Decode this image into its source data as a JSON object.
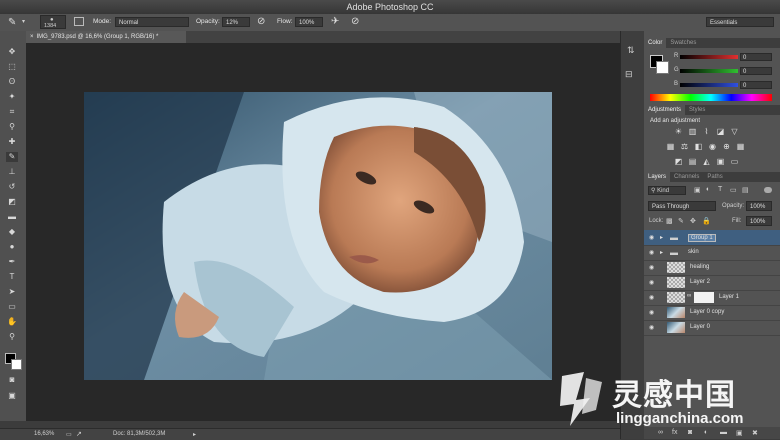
{
  "window": {
    "title": "Adobe Photoshop CC"
  },
  "options_bar": {
    "brush_size": "1384",
    "mode_label": "Mode:",
    "mode_value": "Normal",
    "opacity_label": "Opacity:",
    "opacity_value": "12%",
    "flow_label": "Flow:",
    "flow_value": "100%",
    "workspace": "Essentials"
  },
  "document_tab": {
    "label": "IMG_9783.psd @ 16,6% (Group 1, RGB/16) *"
  },
  "status_bar": {
    "zoom": "16,63%",
    "doc_info": "Doc: 81,3M/502,3M"
  },
  "color_panel": {
    "tabs": [
      "Color",
      "Swatches"
    ],
    "channels": [
      {
        "label": "R",
        "value": "0",
        "color": "#e03030"
      },
      {
        "label": "G",
        "value": "0",
        "color": "#30c030"
      },
      {
        "label": "B",
        "value": "0",
        "color": "#3050e0"
      }
    ]
  },
  "adjustments_panel": {
    "tabs": [
      "Adjustments",
      "Styles"
    ],
    "heading": "Add an adjustment"
  },
  "layers_panel": {
    "tabs": [
      "Layers",
      "Channels",
      "Paths"
    ],
    "kind_label": "Kind",
    "blend_mode": "Pass Through",
    "opacity_label": "Opacity:",
    "opacity_value": "100%",
    "lock_label": "Lock:",
    "fill_label": "Fill:",
    "fill_value": "100%",
    "layers": [
      {
        "name": "Group 1",
        "type": "group",
        "selected": true
      },
      {
        "name": "skin",
        "type": "group",
        "selected": false
      },
      {
        "name": "healing",
        "type": "pixel",
        "selected": false
      },
      {
        "name": "Layer 2",
        "type": "pixel",
        "selected": false
      },
      {
        "name": "Layer 1",
        "type": "mask",
        "selected": false
      },
      {
        "name": "Layer 0 copy",
        "type": "photo",
        "selected": false
      },
      {
        "name": "Layer 0",
        "type": "photo",
        "selected": false
      }
    ]
  },
  "watermark": {
    "logo_text": "灵感中国",
    "url": "lingganchina.com"
  }
}
